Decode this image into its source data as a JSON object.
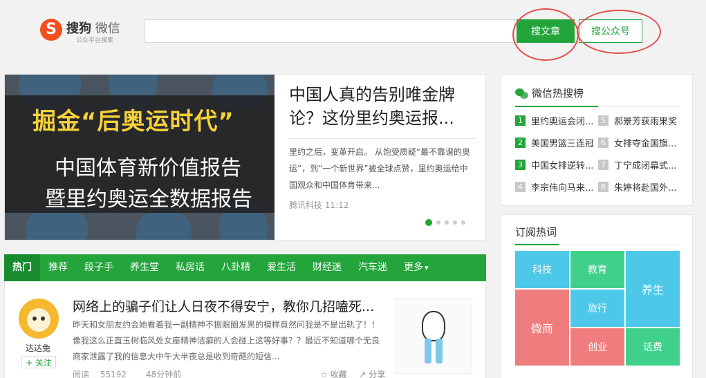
{
  "header": {
    "logo_char": "S",
    "logo_brand": "搜狗",
    "logo_product": "微信",
    "logo_sub": "公众平台搜索",
    "search_value": "",
    "search_article_button": "搜文章",
    "search_account_button": "搜公众号"
  },
  "hero": {
    "image_headline": "掘金“后奥运时代”",
    "image_sub1": "中国体育新价值报告",
    "image_sub2": "暨里约奥运全数据报告",
    "title": "中国人真的告别唯金牌论？这份里约奥运报...",
    "summary": "里约之后，变革开启。 从饱受质疑“最不靠谱的奥运”，到“一个新世界”被全球点赞，里约奥运给中国观众和中国体育带来...",
    "source": "腾讯科技",
    "time": "11:12",
    "slides": 5,
    "active_slide": 1
  },
  "categories": [
    {
      "label": "热门",
      "active": true
    },
    {
      "label": "推荐"
    },
    {
      "label": "段子手"
    },
    {
      "label": "养生堂"
    },
    {
      "label": "私房话"
    },
    {
      "label": "八卦精"
    },
    {
      "label": "爱生活"
    },
    {
      "label": "财经迷"
    },
    {
      "label": "汽车迷"
    },
    {
      "label": "更多",
      "dropdown": true
    }
  ],
  "article": {
    "author": "达达兔",
    "follow_label": "+ 关注",
    "title": "网络上的骗子们让人日夜不得安宁，教你几招嗑死...",
    "summary": "昨天和女朋友约会她看着我一副精神不振眼圈发黑的模样竟然问我是不是出轨了！！像我这么正直玉树临风处女座精神洁癖的人会碰上这等好事？？最近不知道哪个无良商家泄露了我的信息大中午大半夜总是收到奇葩的短信...",
    "reads_label": "阅读",
    "reads": "55192",
    "time": "48分钟前",
    "collect_label": "☆ 收藏",
    "share_label": "↗ 分享"
  },
  "hot_search": {
    "title": "微信热搜榜",
    "items": [
      {
        "rank": "1",
        "text": "里约奥运会闭..."
      },
      {
        "rank": "2",
        "text": "美国男篮三连冠"
      },
      {
        "rank": "3",
        "text": "中国女排逆转..."
      },
      {
        "rank": "4",
        "text": "李宗伟向马来..."
      },
      {
        "rank": "5",
        "text": "郝景芳获雨果奖"
      },
      {
        "rank": "6",
        "text": "女排夺金国旗..."
      },
      {
        "rank": "7",
        "text": "丁宁成闭幕式..."
      },
      {
        "rank": "8",
        "text": "朱婷将赴国外..."
      }
    ]
  },
  "subscribe_tags": {
    "title": "订阅热词",
    "tags": [
      {
        "label": "科技",
        "color": "#4dc8e8"
      },
      {
        "label": "教育",
        "color": "#3fd18c"
      },
      {
        "label": "养生",
        "color": "#4dc8e8"
      },
      {
        "label": "微商",
        "color": "#f07d7d"
      },
      {
        "label": "旅行",
        "color": "#4dc8e8"
      },
      {
        "label": "创业",
        "color": "#f07d7d"
      },
      {
        "label": "话费",
        "color": "#3fd18c"
      }
    ]
  },
  "colors": {
    "brand_green": "#23a53b",
    "logo_orange": "#f34f1e",
    "highlight_ring": "#e64f4f"
  }
}
